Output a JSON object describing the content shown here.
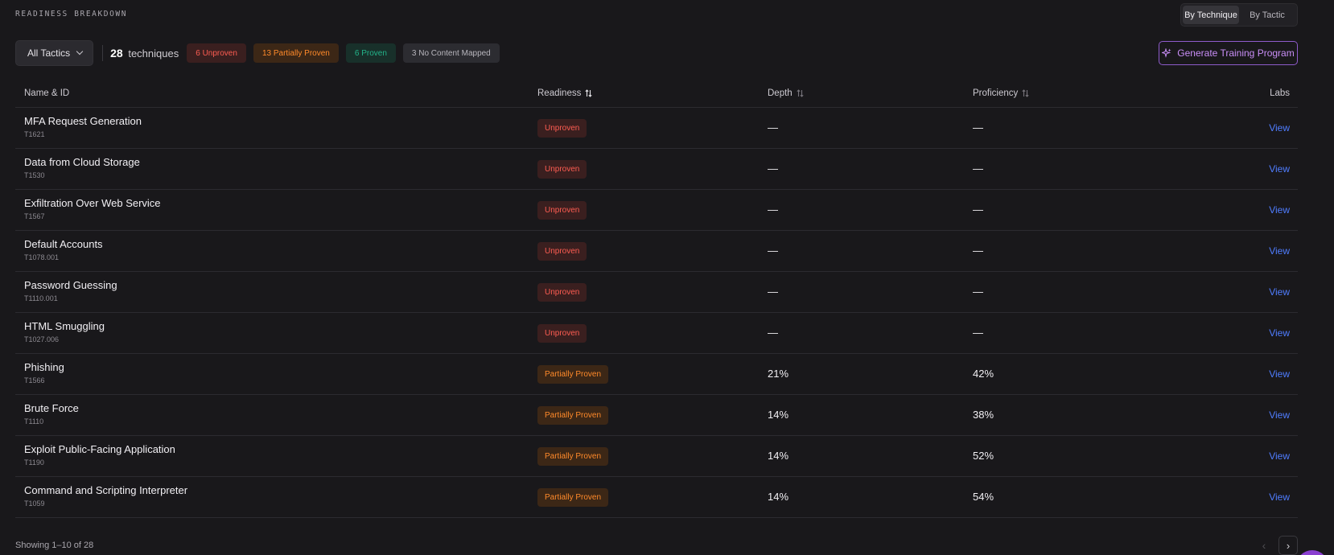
{
  "section_title": "READINESS BREAKDOWN",
  "view_toggle": {
    "by_technique": "By Technique",
    "by_tactic": "By Tactic",
    "active": "by_technique"
  },
  "filters": {
    "tactics_dropdown": "All Tactics",
    "technique_count": "28",
    "technique_label": "techniques",
    "pills": {
      "unproven": "6 Unproven",
      "partially": "13 Partially Proven",
      "proven": "6 Proven",
      "no_content": "3 No Content Mapped"
    }
  },
  "generate_button": "Generate Training Program",
  "table": {
    "headers": {
      "name": "Name & ID",
      "readiness": "Readiness",
      "depth": "Depth",
      "proficiency": "Proficiency",
      "labs": "Labs"
    },
    "rows": [
      {
        "name": "MFA Request Generation",
        "id": "T1621",
        "readiness": "Unproven",
        "status": "red",
        "depth": "—",
        "proficiency": "—",
        "labs": "View"
      },
      {
        "name": "Data from Cloud Storage",
        "id": "T1530",
        "readiness": "Unproven",
        "status": "red",
        "depth": "—",
        "proficiency": "—",
        "labs": "View"
      },
      {
        "name": "Exfiltration Over Web Service",
        "id": "T1567",
        "readiness": "Unproven",
        "status": "red",
        "depth": "—",
        "proficiency": "—",
        "labs": "View"
      },
      {
        "name": "Default Accounts",
        "id": "T1078.001",
        "readiness": "Unproven",
        "status": "red",
        "depth": "—",
        "proficiency": "—",
        "labs": "View"
      },
      {
        "name": "Password Guessing",
        "id": "T1110.001",
        "readiness": "Unproven",
        "status": "red",
        "depth": "—",
        "proficiency": "—",
        "labs": "View"
      },
      {
        "name": "HTML Smuggling",
        "id": "T1027.006",
        "readiness": "Unproven",
        "status": "red",
        "depth": "—",
        "proficiency": "—",
        "labs": "View"
      },
      {
        "name": "Phishing",
        "id": "T1566",
        "readiness": "Partially Proven",
        "status": "orange",
        "depth": "21%",
        "proficiency": "42%",
        "labs": "View"
      },
      {
        "name": "Brute Force",
        "id": "T1110",
        "readiness": "Partially Proven",
        "status": "orange",
        "depth": "14%",
        "proficiency": "38%",
        "labs": "View"
      },
      {
        "name": "Exploit Public-Facing Application",
        "id": "T1190",
        "readiness": "Partially Proven",
        "status": "orange",
        "depth": "14%",
        "proficiency": "52%",
        "labs": "View"
      },
      {
        "name": "Command and Scripting Interpreter",
        "id": "T1059",
        "readiness": "Partially Proven",
        "status": "orange",
        "depth": "14%",
        "proficiency": "54%",
        "labs": "View"
      }
    ]
  },
  "footer": {
    "showing": "Showing 1–10 of 28",
    "prev": "‹",
    "next": "›"
  },
  "colors": {
    "accent_purple": "#c98ef7",
    "link_blue": "#4f7dff",
    "unproven": "#ff5d52",
    "partial": "#ff8a2a",
    "proven": "#23b48a"
  }
}
